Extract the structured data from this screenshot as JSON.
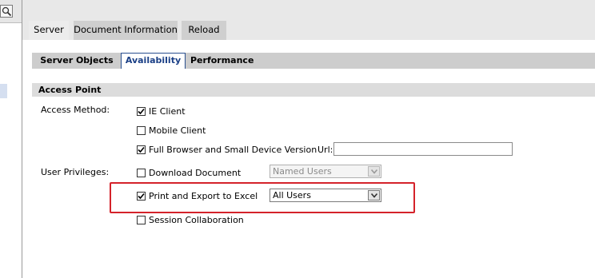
{
  "tabs": [
    "Server",
    "Document Information",
    "Reload"
  ],
  "subtabs": [
    "Server Objects",
    "Availability",
    "Performance"
  ],
  "section": {
    "title": "Access Point"
  },
  "labels": {
    "access_method": "Access Method:",
    "user_privileges": "User Privileges:",
    "url": "Url:"
  },
  "access_methods": [
    {
      "label": "IE Client",
      "checked": true
    },
    {
      "label": "Mobile Client",
      "checked": false
    },
    {
      "label": "Full Browser and Small Device Version",
      "checked": true
    }
  ],
  "url": {
    "value": ""
  },
  "privileges": [
    {
      "label": "Download Document",
      "checked": false,
      "select_value": "Named Users",
      "select_disabled": true
    },
    {
      "label": "Print and Export to Excel",
      "checked": true,
      "select_value": "All Users",
      "select_disabled": false
    },
    {
      "label": "Session Collaboration",
      "checked": false
    }
  ],
  "colors": {
    "highlight": "#d4222a",
    "active_subtab": "#1a3f86"
  }
}
